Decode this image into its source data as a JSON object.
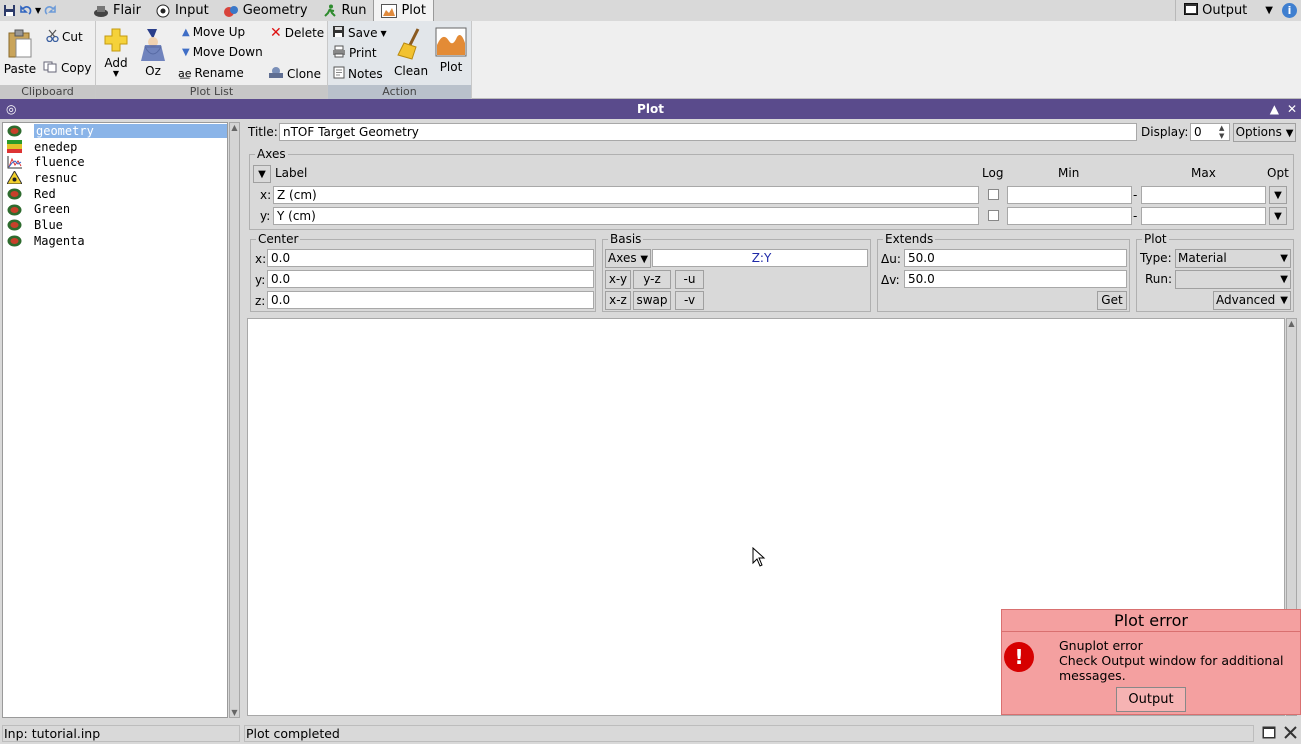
{
  "menubar": {
    "tabs": [
      {
        "label": "Flair",
        "icon": "flair-icon"
      },
      {
        "label": "Input",
        "icon": "input-icon"
      },
      {
        "label": "Geometry",
        "icon": "geometry-icon"
      },
      {
        "label": "Run",
        "icon": "run-icon"
      },
      {
        "label": "Plot",
        "icon": "plot-icon",
        "active": true
      }
    ],
    "output_label": "Output"
  },
  "ribbon": {
    "clipboard": {
      "group_label": "Clipboard",
      "paste": "Paste",
      "cut": "Cut",
      "copy": "Copy"
    },
    "plotlist": {
      "group_label": "Plot List",
      "add": "Add",
      "oz": "Oz",
      "move_up": "Move Up",
      "move_down": "Move Down",
      "rename": "Rename",
      "delete": "Delete",
      "clone": "Clone"
    },
    "action": {
      "group_label": "Action",
      "save": "Save",
      "print": "Print",
      "notes": "Notes",
      "clean": "Clean",
      "plot": "Plot"
    }
  },
  "window": {
    "title": "Plot"
  },
  "plot_list": [
    {
      "label": "geometry",
      "icon": "geometry-plot-icon",
      "selected": true
    },
    {
      "label": "enedep",
      "icon": "usrbin-icon"
    },
    {
      "label": "fluence",
      "icon": "usr1d-icon"
    },
    {
      "label": "resnuc",
      "icon": "resnuclei-icon"
    },
    {
      "label": "Red",
      "icon": "geometry-plot-icon"
    },
    {
      "label": "Green",
      "icon": "geometry-plot-icon"
    },
    {
      "label": "Blue",
      "icon": "geometry-plot-icon"
    },
    {
      "label": "Magenta",
      "icon": "geometry-plot-icon"
    }
  ],
  "form": {
    "title_label": "Title:",
    "title_value": "nTOF Target Geometry",
    "display_label": "Display:",
    "display_value": "0",
    "options_label": "Options",
    "axes": {
      "frame_label": "Axes",
      "col_label": "Label",
      "col_log": "Log",
      "col_min": "Min",
      "col_max": "Max",
      "col_opt": "Opt",
      "rows": [
        {
          "axis": "x:",
          "label": "Z (cm)",
          "min": "",
          "max": ""
        },
        {
          "axis": "y:",
          "label": "Y (cm)",
          "min": "",
          "max": ""
        }
      ],
      "dash": "-"
    },
    "center": {
      "frame_label": "Center",
      "x_label": "x:",
      "x": "0.0",
      "y_label": "y:",
      "y": "0.0",
      "z_label": "z:",
      "z": "0.0"
    },
    "basis": {
      "frame_label": "Basis",
      "mode": "Axes",
      "value": "Z:Y",
      "buttons": [
        "x-y",
        "y-z",
        "-u",
        "x-z",
        "swap",
        "-v"
      ]
    },
    "extends": {
      "frame_label": "Extends",
      "du_label": "Δu:",
      "du": "50.0",
      "dv_label": "Δv:",
      "dv": "50.0",
      "get_label": "Get"
    },
    "plot": {
      "frame_label": "Plot",
      "type_label": "Type:",
      "type_value": "Material",
      "run_label": "Run:",
      "run_value": "",
      "advanced_label": "Advanced"
    }
  },
  "error_popup": {
    "title": "Plot error",
    "line1": "Gnuplot error",
    "line2": "Check Output window for additional messages.",
    "button": "Output"
  },
  "status": {
    "left": "Inp: tutorial.inp",
    "main": "Plot completed"
  },
  "colors": {
    "titlebar": "#5a4b8c",
    "selection": "#8ab4e8",
    "error_bg": "#f4a0a0",
    "error_icon": "#d60000"
  }
}
